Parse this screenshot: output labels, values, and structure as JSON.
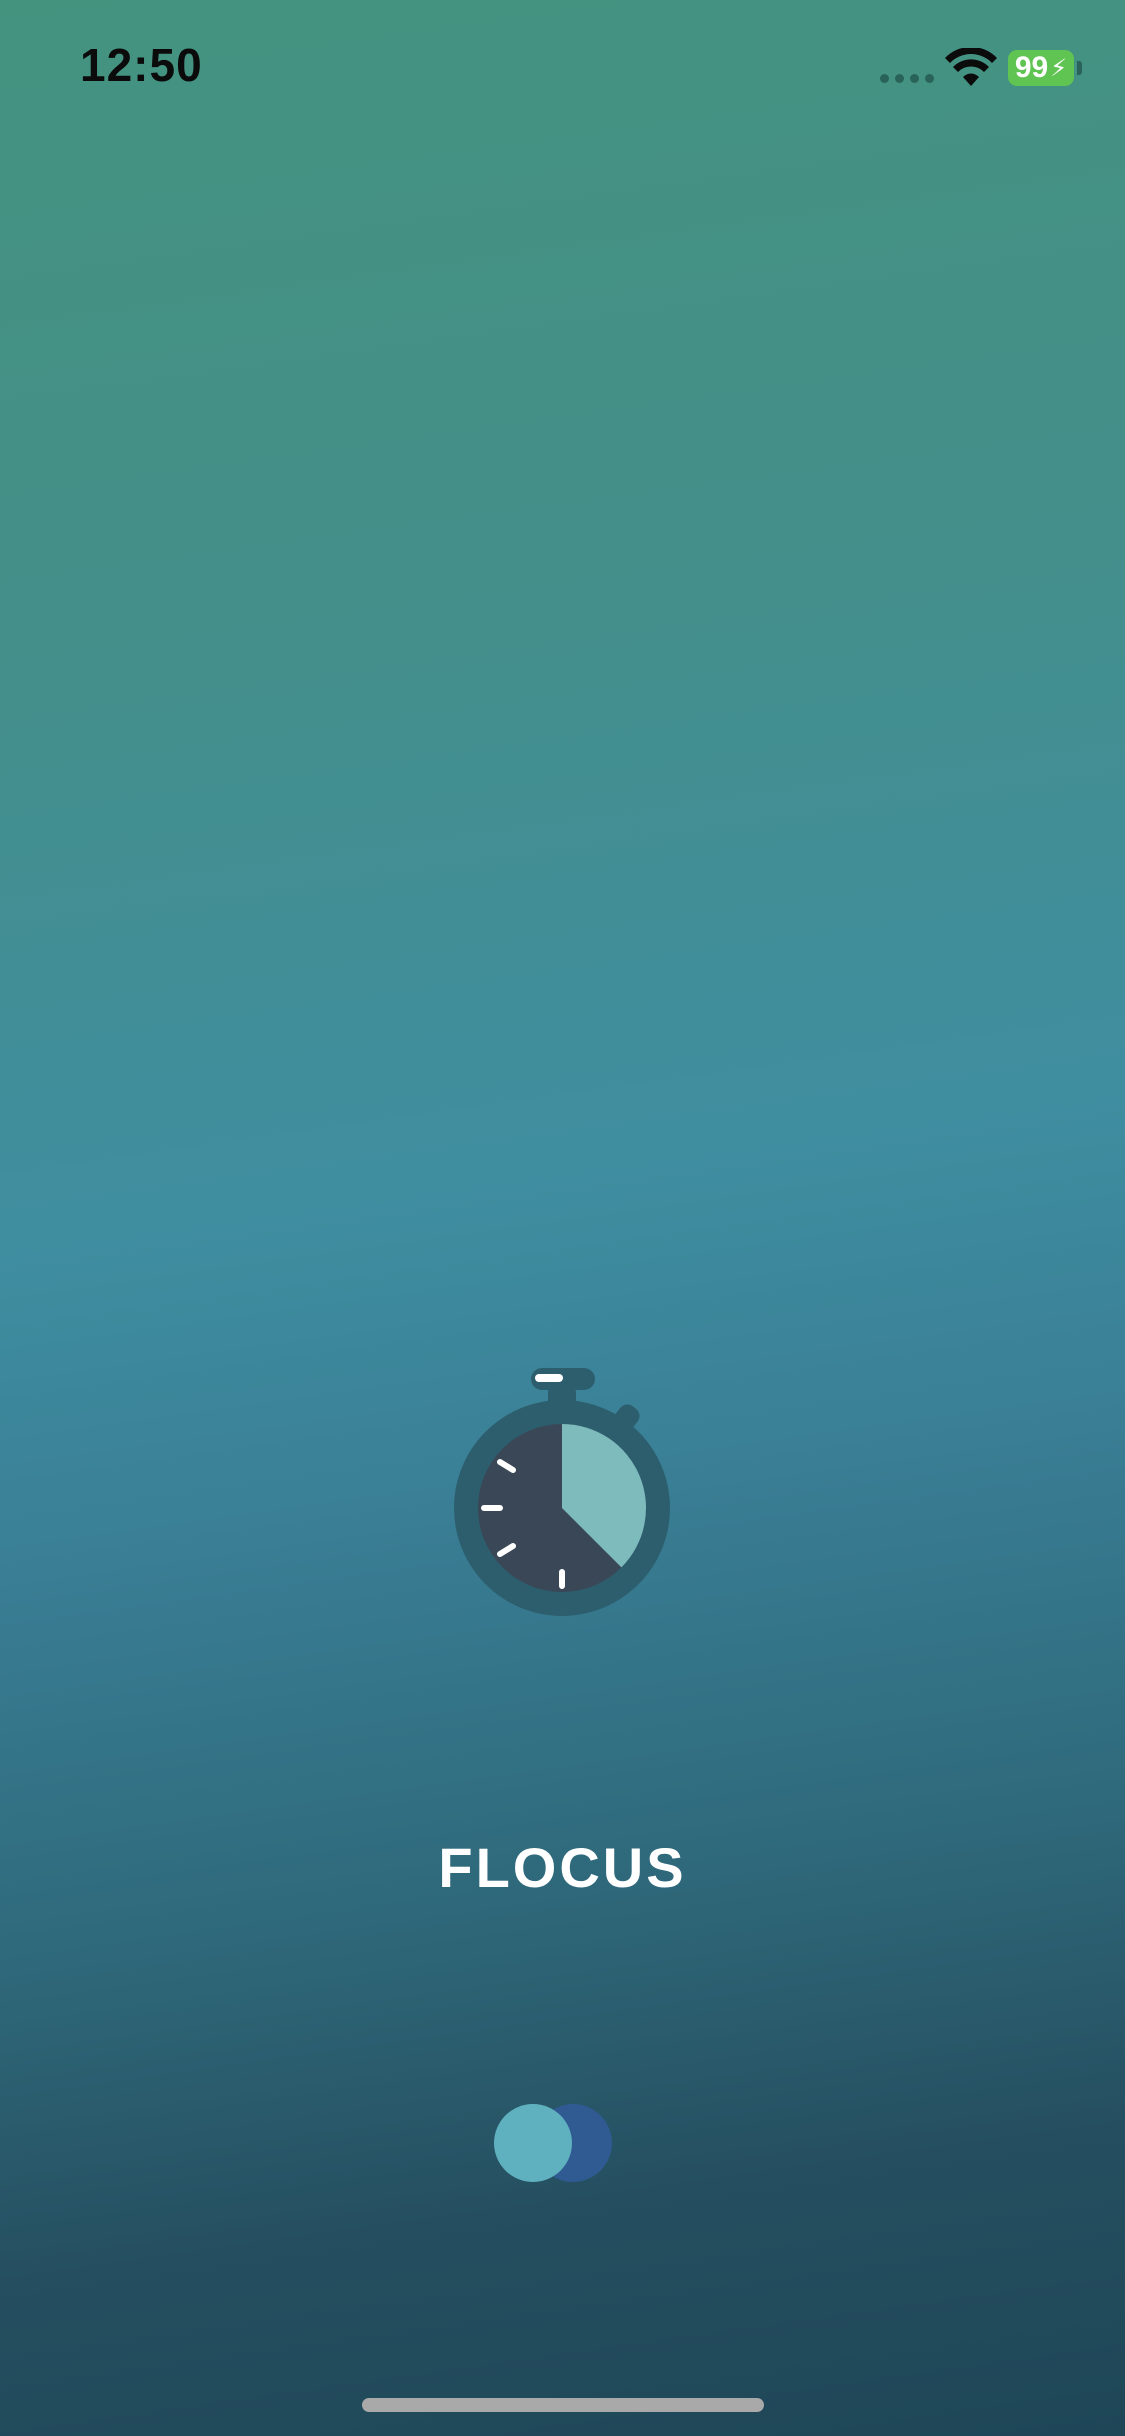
{
  "status_bar": {
    "time": "12:50",
    "battery_level": "99",
    "battery_charging_icon": "bolt-icon",
    "wifi_icon": "wifi-icon",
    "signal_icon": "cellular-signal-icon"
  },
  "splash": {
    "logo_icon": "stopwatch-icon",
    "app_name": "FLOCUS",
    "loading_indicator": "loading-dots-icon"
  },
  "colors": {
    "gradient_top": "#44937f",
    "gradient_mid": "#3f8ea0",
    "gradient_bottom": "#1e4657",
    "battery": "#5fc451",
    "loader_front": "#5fb1c0",
    "loader_back": "#2f5a92"
  }
}
